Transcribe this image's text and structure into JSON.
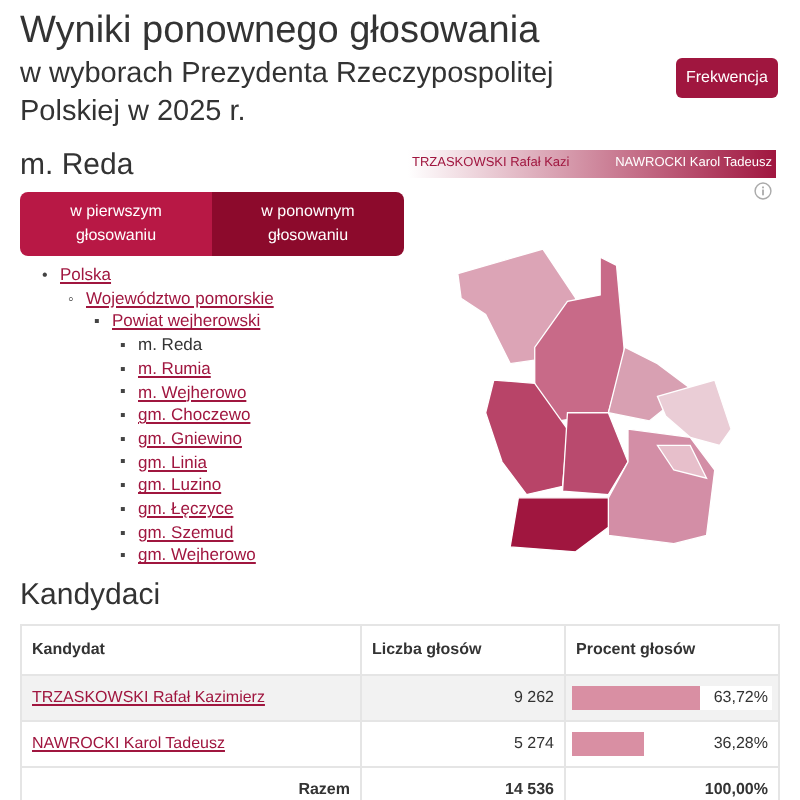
{
  "title": "Wyniki ponownego głosowania",
  "subtitle": "w wyborach Prezydenta Rzeczypospolitej Polskiej w 2025 r.",
  "turnout_button": "Frekwencja",
  "area": "m. Reda",
  "tabs": [
    {
      "label": "w pierwszym głosowaniu",
      "selected": false
    },
    {
      "label": "w ponownym głosowaniu",
      "selected": true
    }
  ],
  "tree": [
    {
      "bullet": "•",
      "label": "Polska",
      "selected": false,
      "children": [
        {
          "bullet": "◦",
          "label": "Województwo pomorskie",
          "selected": false,
          "children": [
            {
              "bullet": "▪",
              "label": "Powiat wejherowski",
              "selected": false,
              "children": [
                {
                  "bullet": "▪",
                  "label": "m. Reda",
                  "selected": true
                },
                {
                  "bullet": "▪",
                  "label": "m. Rumia",
                  "selected": false
                },
                {
                  "bullet": "▪",
                  "label": "m. Wejherowo",
                  "selected": false
                },
                {
                  "bullet": "▪",
                  "label": "gm. Choczewo",
                  "selected": false
                },
                {
                  "bullet": "▪",
                  "label": "gm. Gniewino",
                  "selected": false
                },
                {
                  "bullet": "▪",
                  "label": "gm. Linia",
                  "selected": false
                },
                {
                  "bullet": "▪",
                  "label": "gm. Luzino",
                  "selected": false
                },
                {
                  "bullet": "▪",
                  "label": "gm. Łęczyce",
                  "selected": false
                },
                {
                  "bullet": "▪",
                  "label": "gm. Szemud",
                  "selected": false
                },
                {
                  "bullet": "▪",
                  "label": "gm. Wejherowo",
                  "selected": false
                }
              ]
            }
          ]
        }
      ]
    }
  ],
  "legend": {
    "left": "TRZASKOWSKI Rafał Kazi",
    "right": "NAWROCKI Karol Tadeusz"
  },
  "candidates_heading": "Kandydaci",
  "table": {
    "columns": [
      "Kandydat",
      "Liczba głosów",
      "Procent głosów"
    ],
    "rows": [
      {
        "name": "TRZASKOWSKI Rafał Kazimierz",
        "votes": "9 262",
        "percent": "63,72%",
        "level": 0.6372
      },
      {
        "name": "NAWROCKI Karol Tadeusz",
        "votes": "5 274",
        "percent": "36,28%",
        "level": 0.3628
      }
    ],
    "total": {
      "label": "Razem",
      "votes": "14 536",
      "percent": "100,00%"
    }
  }
}
